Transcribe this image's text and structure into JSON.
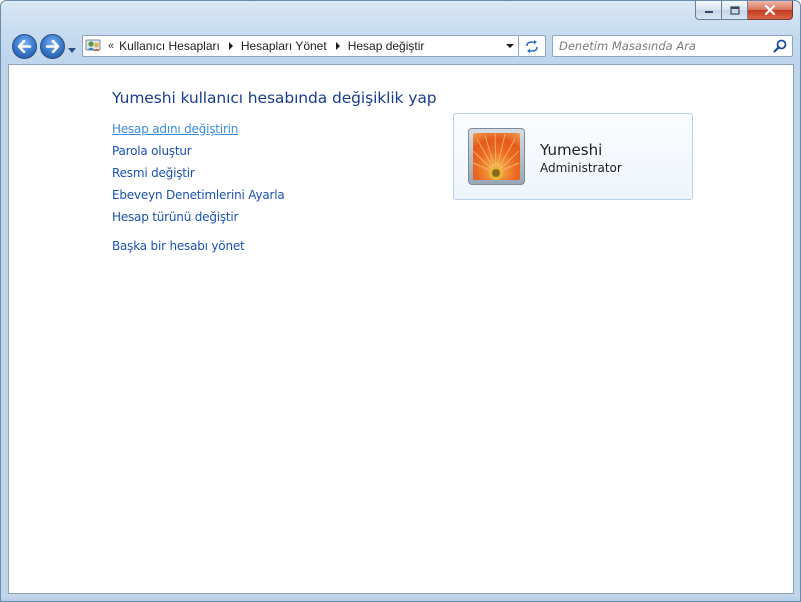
{
  "window": {
    "caption_buttons": [
      {
        "name": "minimize",
        "icon": "minimize-icon"
      },
      {
        "name": "maximize",
        "icon": "maximize-icon"
      },
      {
        "name": "close",
        "icon": "close-icon"
      }
    ]
  },
  "navbar": {
    "back_icon": "back-arrow-icon",
    "forward_icon": "forward-arrow-icon",
    "recent_icon": "chevron-down-icon",
    "overflow_label": "«",
    "breadcrumbs": [
      "Kullanıcı Hesapları",
      "Hesapları Yönet",
      "Hesap değiştir"
    ],
    "refresh_icon": "refresh-icon",
    "search_placeholder": "Denetim Masasında Ara"
  },
  "main": {
    "title": "Yumeshi kullanıcı hesabında değişiklik yap",
    "tasks": [
      {
        "label": "Hesap adını değiştirin",
        "state": "hover"
      },
      {
        "label": "Parola oluştur"
      },
      {
        "label": "Resmi değiştir"
      },
      {
        "label": "Ebeveyn Denetimlerini Ayarla"
      },
      {
        "label": "Hesap türünü değiştir"
      }
    ],
    "other_task": {
      "label": "Başka bir hesabı yönet"
    },
    "account": {
      "name": "Yumeshi",
      "type": "Administrator",
      "picture": "flower-avatar"
    }
  },
  "colors": {
    "link": "#1a52b0",
    "link_hover": "#3a8ce0",
    "title": "#1a3e8c",
    "chrome": "#c8dcf0"
  }
}
